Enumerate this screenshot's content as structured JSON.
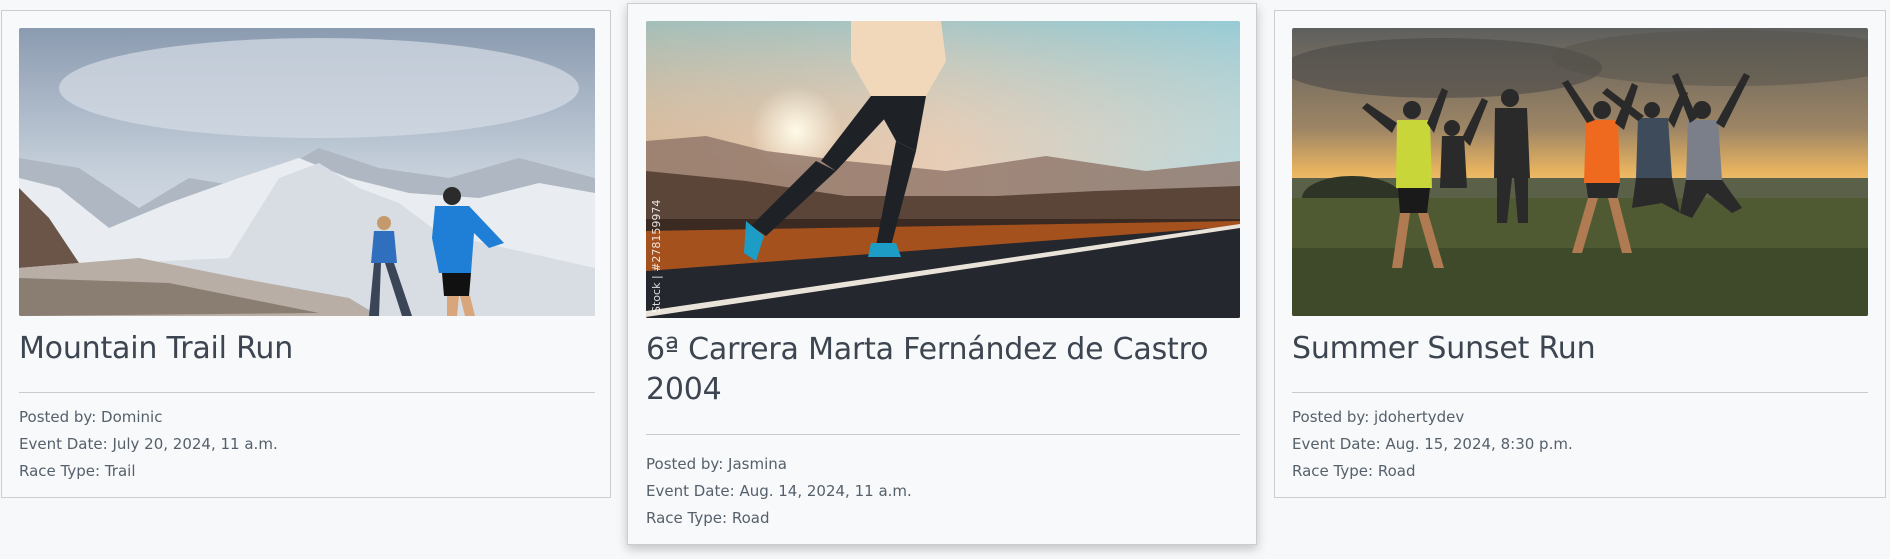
{
  "cards": [
    {
      "title": "Mountain Trail Run",
      "posted_label": "Posted by:",
      "posted_by": "Dominic",
      "date_label": "Event Date:",
      "event_date": "July 20, 2024, 11 a.m.",
      "type_label": "Race Type:",
      "race_type": "Trail",
      "image": "mountain-trail-photo"
    },
    {
      "title": "6ª Carrera Marta Fernández de Castro 2004",
      "posted_label": "Posted by:",
      "posted_by": "Jasmina",
      "date_label": "Event Date:",
      "event_date": "Aug. 14, 2024, 11 a.m.",
      "type_label": "Race Type:",
      "race_type": "Road",
      "image": "road-runner-sunset-photo",
      "watermark": "Stock | #278159974"
    },
    {
      "title": "Summer Sunset Run",
      "posted_label": "Posted by:",
      "posted_by": "jdohertydev",
      "date_label": "Event Date:",
      "event_date": "Aug. 15, 2024, 8:30 p.m.",
      "type_label": "Race Type:",
      "race_type": "Road",
      "image": "group-jumping-sunset-photo"
    }
  ]
}
